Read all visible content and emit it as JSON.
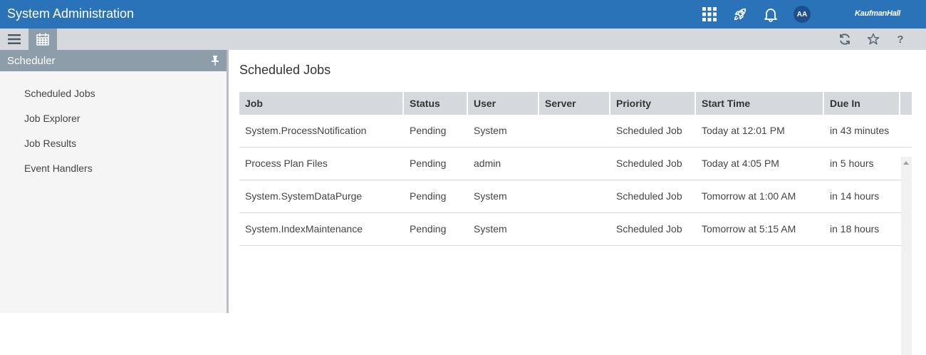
{
  "header": {
    "title": "System Administration",
    "avatar_initials": "AA",
    "brand": "KaufmanHall",
    "icons": [
      "apps-grid-icon",
      "rocket-icon",
      "bell-icon"
    ],
    "color": "#2a73b8"
  },
  "toolbar": {
    "left_icons": [
      "hamburger-menu-icon",
      "calendar-icon"
    ],
    "right_icons": [
      "refresh-icon",
      "star-icon",
      "help-icon"
    ],
    "help_label": "?"
  },
  "sidebar": {
    "title": "Scheduler",
    "items": [
      {
        "label": "Scheduled Jobs"
      },
      {
        "label": "Job Explorer"
      },
      {
        "label": "Job Results"
      },
      {
        "label": "Event Handlers"
      }
    ]
  },
  "main": {
    "title": "Scheduled Jobs",
    "columns": [
      "Job",
      "Status",
      "User",
      "Server",
      "Priority",
      "Start Time",
      "Due In"
    ],
    "rows": [
      {
        "job": "System.ProcessNotification",
        "status": "Pending",
        "user": "System",
        "server": "",
        "priority": "Scheduled Job",
        "start": "Today at 12:01 PM",
        "due": "in 43 minutes"
      },
      {
        "job": "Process Plan Files",
        "status": "Pending",
        "user": "admin",
        "server": "",
        "priority": "Scheduled Job",
        "start": "Today at 4:05 PM",
        "due": "in 5 hours"
      },
      {
        "job": "System.SystemDataPurge",
        "status": "Pending",
        "user": "System",
        "server": "",
        "priority": "Scheduled Job",
        "start": "Tomorrow at 1:00 AM",
        "due": "in 14 hours"
      },
      {
        "job": "System.IndexMaintenance",
        "status": "Pending",
        "user": "System",
        "server": "",
        "priority": "Scheduled Job",
        "start": "Tomorrow at 5:15 AM",
        "due": "in 18 hours"
      }
    ]
  }
}
